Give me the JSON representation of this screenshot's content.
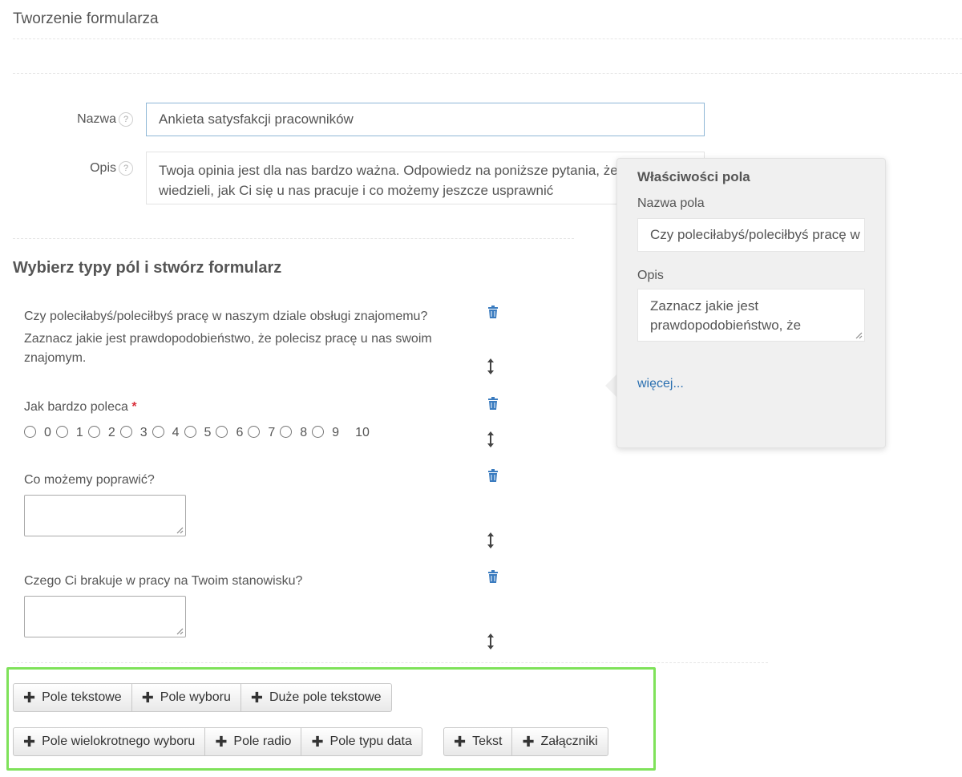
{
  "page": {
    "title": "Tworzenie formularza"
  },
  "form": {
    "name_label": "Nazwa",
    "name_value": "Ankieta satysfakcji pracowników",
    "desc_label": "Opis",
    "desc_line1": "Twoja opinia jest dla nas bardzo ważna. Odpowiedz na poniższe pytania, że",
    "desc_line2": "wiedzieli, jak Ci się u nas pracuje i co możemy jeszcze usprawnić",
    "help_glyph": "?"
  },
  "section": {
    "title": "Wybierz typy pól i stwórz formularz"
  },
  "questions": [
    {
      "text": "Czy poleciłabyś/poleciłbyś pracę w naszym dziale obsługi znajomemu?",
      "desc_line1": "Zaznacz jakie jest prawdopodobieństwo, że polecisz pracę u nas swoim",
      "desc_line2": "znajomym."
    },
    {
      "text": "Jak bardzo poleca",
      "required_mark": "*",
      "options": [
        "0",
        "1",
        "2",
        "3",
        "4",
        "5",
        "6",
        "7",
        "8",
        "9",
        "10"
      ]
    },
    {
      "text": "Co możemy poprawić?"
    },
    {
      "text": "Czego Ci brakuje w pracy na Twoim stanowisku?"
    }
  ],
  "properties": {
    "title": "Właściwości pola",
    "name_label": "Nazwa pola",
    "name_value": "Czy poleciłabyś/poleciłbyś pracę w",
    "desc_label": "Opis",
    "desc_line1": "Zaznacz jakie jest",
    "desc_line2": "prawdopodobieństwo, że",
    "more_link": "więcej..."
  },
  "toolbar": {
    "row1": [
      "Pole tekstowe",
      "Pole wyboru",
      "Duże pole tekstowe"
    ],
    "row2a": [
      "Pole wielokrotnego wyboru",
      "Pole radio",
      "Pole typu data"
    ],
    "row2b": [
      "Tekst",
      "Załączniki"
    ],
    "plus_glyph": "✚"
  },
  "colors": {
    "accent_link": "#2a6fb0",
    "trash_icon": "#3a7bbf",
    "highlight_border": "#7fe25a",
    "required": "#d9303b"
  },
  "icons": {
    "delete": "trash-icon",
    "move": "drag-handle-icon",
    "help": "help-icon",
    "add": "plus-icon"
  }
}
